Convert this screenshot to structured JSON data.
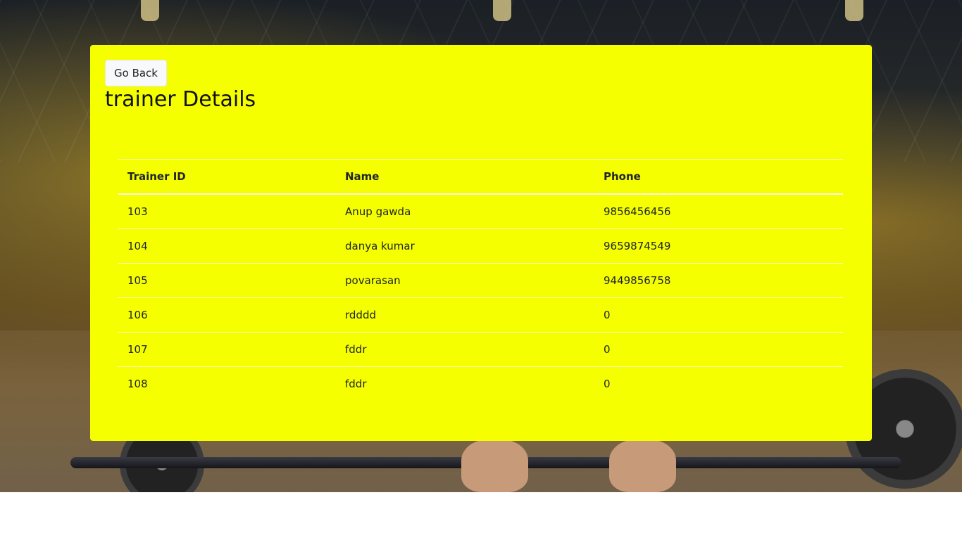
{
  "actions": {
    "go_back_label": "Go Back"
  },
  "page": {
    "title": "trainer Details"
  },
  "table": {
    "headers": [
      "Trainer ID",
      "Name",
      "Phone"
    ],
    "rows": [
      [
        "103",
        "Anup gawda",
        "9856456456"
      ],
      [
        "104",
        "danya kumar",
        "9659874549"
      ],
      [
        "105",
        "povarasan",
        "9449856758"
      ],
      [
        "106",
        "rdddd",
        "0"
      ],
      [
        "107",
        "fddr",
        "0"
      ],
      [
        "108",
        "fddr",
        "0"
      ]
    ]
  },
  "colors": {
    "card_background": "#f5ff00",
    "text": "#111111"
  }
}
